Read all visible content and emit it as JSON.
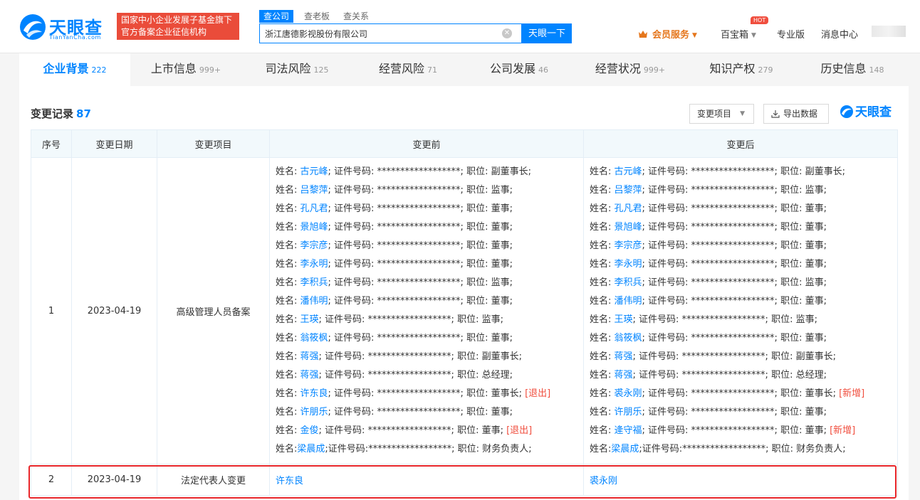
{
  "header": {
    "logo_text": "天眼查",
    "logo_sub": "TianYanCha.com",
    "gov_badge_line1": "国家中小企业发展子基金旗下",
    "gov_badge_line2": "官方备案企业征信机构",
    "search_tabs": [
      "查公司",
      "查老板",
      "查关系"
    ],
    "search_value": "浙江唐德影视股份有限公司",
    "search_button": "天眼一下",
    "vip_label": "会员服务",
    "baoxiang_label": "百宝箱",
    "hot_badge": "HOT",
    "pro_label": "专业版",
    "msg_label": "消息中心"
  },
  "main_tabs": [
    {
      "label": "企业背景",
      "count": "222"
    },
    {
      "label": "上市信息",
      "count": "999+"
    },
    {
      "label": "司法风险",
      "count": "125"
    },
    {
      "label": "经营风险",
      "count": "71"
    },
    {
      "label": "公司发展",
      "count": "46"
    },
    {
      "label": "经营状况",
      "count": "999+"
    },
    {
      "label": "知识产权",
      "count": "279"
    },
    {
      "label": "历史信息",
      "count": "148"
    }
  ],
  "section": {
    "title": "变更记录",
    "count": "87",
    "filter_label": "变更项目",
    "export_label": "导出数据",
    "brand": "天眼查"
  },
  "table": {
    "headers": [
      "序号",
      "变更日期",
      "变更项目",
      "变更前",
      "变更后"
    ],
    "rows": [
      {
        "index": "1",
        "date": "2023-04-19",
        "item": "高级管理人员备案",
        "before": [
          {
            "pre": "姓名: ",
            "name": "古元峰",
            "post": "; 证件号码: ******************; 职位: 副董事长;",
            "tag": ""
          },
          {
            "pre": "姓名: ",
            "name": "吕黎萍",
            "post": "; 证件号码: ******************; 职位: 监事;",
            "tag": ""
          },
          {
            "pre": "姓名: ",
            "name": "孔凡君",
            "post": "; 证件号码: ******************; 职位: 董事;",
            "tag": ""
          },
          {
            "pre": "姓名: ",
            "name": "景旭峰",
            "post": "; 证件号码: ******************; 职位: 董事;",
            "tag": ""
          },
          {
            "pre": "姓名: ",
            "name": "李宗彦",
            "post": "; 证件号码: ******************; 职位: 董事;",
            "tag": ""
          },
          {
            "pre": "姓名: ",
            "name": "李永明",
            "post": "; 证件号码: ******************; 职位: 董事;",
            "tag": ""
          },
          {
            "pre": "姓名: ",
            "name": "李积兵",
            "post": "; 证件号码: ******************; 职位: 监事;",
            "tag": ""
          },
          {
            "pre": "姓名: ",
            "name": "潘伟明",
            "post": "; 证件号码: ******************; 职位: 董事;",
            "tag": ""
          },
          {
            "pre": "姓名: ",
            "name": "王瑛",
            "post": "; 证件号码: ******************; 职位: 监事;",
            "tag": ""
          },
          {
            "pre": "姓名: ",
            "name": "翁筱枫",
            "post": "; 证件号码: ******************; 职位: 董事;",
            "tag": ""
          },
          {
            "pre": "姓名: ",
            "name": "蒋强",
            "post": "; 证件号码: ******************; 职位: 副董事长;",
            "tag": ""
          },
          {
            "pre": "姓名: ",
            "name": "蒋强",
            "post": "; 证件号码: ******************; 职位: 总经理;",
            "tag": ""
          },
          {
            "pre": "姓名: ",
            "name": "许东良",
            "post": "; 证件号码: ******************; 职位: 董事长;",
            "tag": "[退出]"
          },
          {
            "pre": "姓名: ",
            "name": "许朋乐",
            "post": "; 证件号码: ******************; 职位: 董事;",
            "tag": ""
          },
          {
            "pre": "姓名: ",
            "name": "金俊",
            "post": "; 证件号码: ******************; 职位: 董事;",
            "tag": "[退出]"
          },
          {
            "pre": "姓名:",
            "name": "梁晨成",
            "post": ";证件号码:******************; 职位: 财务负责人;",
            "tag": ""
          }
        ],
        "after": [
          {
            "pre": "姓名: ",
            "name": "古元峰",
            "post": "; 证件号码: ******************; 职位: 副董事长;",
            "tag": ""
          },
          {
            "pre": "姓名: ",
            "name": "吕黎萍",
            "post": "; 证件号码: ******************; 职位: 监事;",
            "tag": ""
          },
          {
            "pre": "姓名: ",
            "name": "孔凡君",
            "post": "; 证件号码: ******************; 职位: 董事;",
            "tag": ""
          },
          {
            "pre": "姓名: ",
            "name": "景旭峰",
            "post": "; 证件号码: ******************; 职位: 董事;",
            "tag": ""
          },
          {
            "pre": "姓名: ",
            "name": "李宗彦",
            "post": "; 证件号码: ******************; 职位: 董事;",
            "tag": ""
          },
          {
            "pre": "姓名: ",
            "name": "李永明",
            "post": "; 证件号码: ******************; 职位: 董事;",
            "tag": ""
          },
          {
            "pre": "姓名: ",
            "name": "李积兵",
            "post": "; 证件号码: ******************; 职位: 监事;",
            "tag": ""
          },
          {
            "pre": "姓名: ",
            "name": "潘伟明",
            "post": "; 证件号码: ******************; 职位: 董事;",
            "tag": ""
          },
          {
            "pre": "姓名: ",
            "name": "王瑛",
            "post": "; 证件号码: ******************; 职位: 监事;",
            "tag": ""
          },
          {
            "pre": "姓名: ",
            "name": "翁筱枫",
            "post": "; 证件号码: ******************; 职位: 董事;",
            "tag": ""
          },
          {
            "pre": "姓名: ",
            "name": "蒋强",
            "post": "; 证件号码: ******************; 职位: 副董事长;",
            "tag": ""
          },
          {
            "pre": "姓名: ",
            "name": "蒋强",
            "post": "; 证件号码: ******************; 职位: 总经理;",
            "tag": ""
          },
          {
            "pre": "姓名: ",
            "name": "裘永刚",
            "post": "; 证件号码: ******************; 职位: 董事长;",
            "tag": "[新增]"
          },
          {
            "pre": "姓名: ",
            "name": "许朋乐",
            "post": "; 证件号码: ******************; 职位: 董事;",
            "tag": ""
          },
          {
            "pre": "姓名: ",
            "name": "逄守福",
            "post": "; 证件号码: ******************; 职位: 董事;",
            "tag": "[新增]"
          },
          {
            "pre": "姓名:",
            "name": "梁晨成",
            "post": ";证件号码:******************; 职位: 财务负责人;",
            "tag": ""
          }
        ]
      },
      {
        "index": "2",
        "date": "2023-04-19",
        "item": "法定代表人变更",
        "before_name": "许东良",
        "after_name": "裘永刚"
      }
    ]
  },
  "colors": {
    "accent": "#0084ff",
    "danger": "#f04e3e",
    "vip": "#e5761c",
    "highlight_border": "#e8262a"
  }
}
